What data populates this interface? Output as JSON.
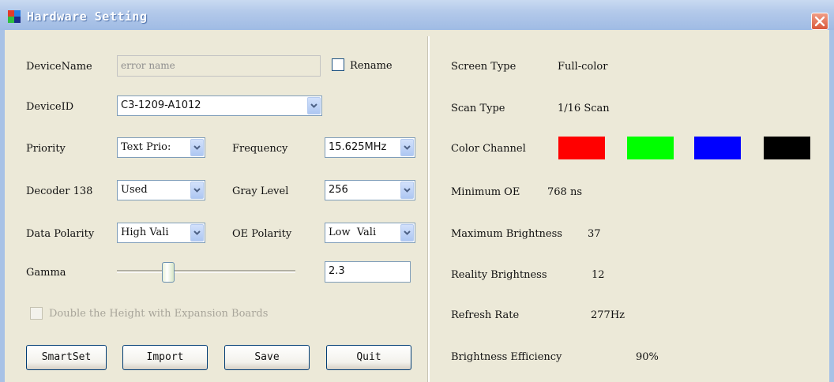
{
  "window": {
    "title": "Hardware Setting",
    "close_icon": "close-icon"
  },
  "left": {
    "device_name": {
      "label": "DeviceName",
      "value": "error name",
      "rename_label": "Rename",
      "rename_checked": false
    },
    "device_id": {
      "label": "DeviceID",
      "value": "C3-1209-A1012"
    },
    "priority": {
      "label": "Priority",
      "value": "Text Prio:"
    },
    "frequency": {
      "label": "Frequency",
      "value": "15.625MHz"
    },
    "decoder": {
      "label": "Decoder 138",
      "value": "Used"
    },
    "gray_level": {
      "label": "Gray Level",
      "value": "256"
    },
    "data_polarity": {
      "label": "Data Polarity",
      "value": "High Vali"
    },
    "oe_polarity": {
      "label": "OE Polarity",
      "value": "Low  Vali"
    },
    "gamma": {
      "label": "Gamma",
      "value": "2.3",
      "slider_position": 0.27
    },
    "double_height": {
      "label": "Double the Height with Expansion Boards",
      "checked": false,
      "enabled": false
    },
    "buttons": {
      "smartset": "SmartSet",
      "import": "Import",
      "save": "Save",
      "quit": "Quit"
    }
  },
  "right": {
    "screen_type": {
      "label": "Screen Type",
      "value": "Full-color"
    },
    "scan_type": {
      "label": "Scan Type",
      "value": "1/16 Scan"
    },
    "color_channel": {
      "label": "Color Channel",
      "colors": [
        "#ff0000",
        "#00ff00",
        "#0000ff",
        "#000000"
      ]
    },
    "minimum_oe": {
      "label": "Minimum OE",
      "value": "768 ns"
    },
    "max_brightness": {
      "label": "Maximum Brightness",
      "value": "37"
    },
    "reality_brightness": {
      "label": "Reality Brightness",
      "value": "12"
    },
    "refresh_rate": {
      "label": "Refresh Rate",
      "value": "277Hz"
    },
    "brightness_efficiency": {
      "label": "Brightness Efficiency",
      "value": "90%"
    }
  },
  "colors": {
    "titlebar": "#b3c9ea",
    "close": "#d9573b"
  }
}
